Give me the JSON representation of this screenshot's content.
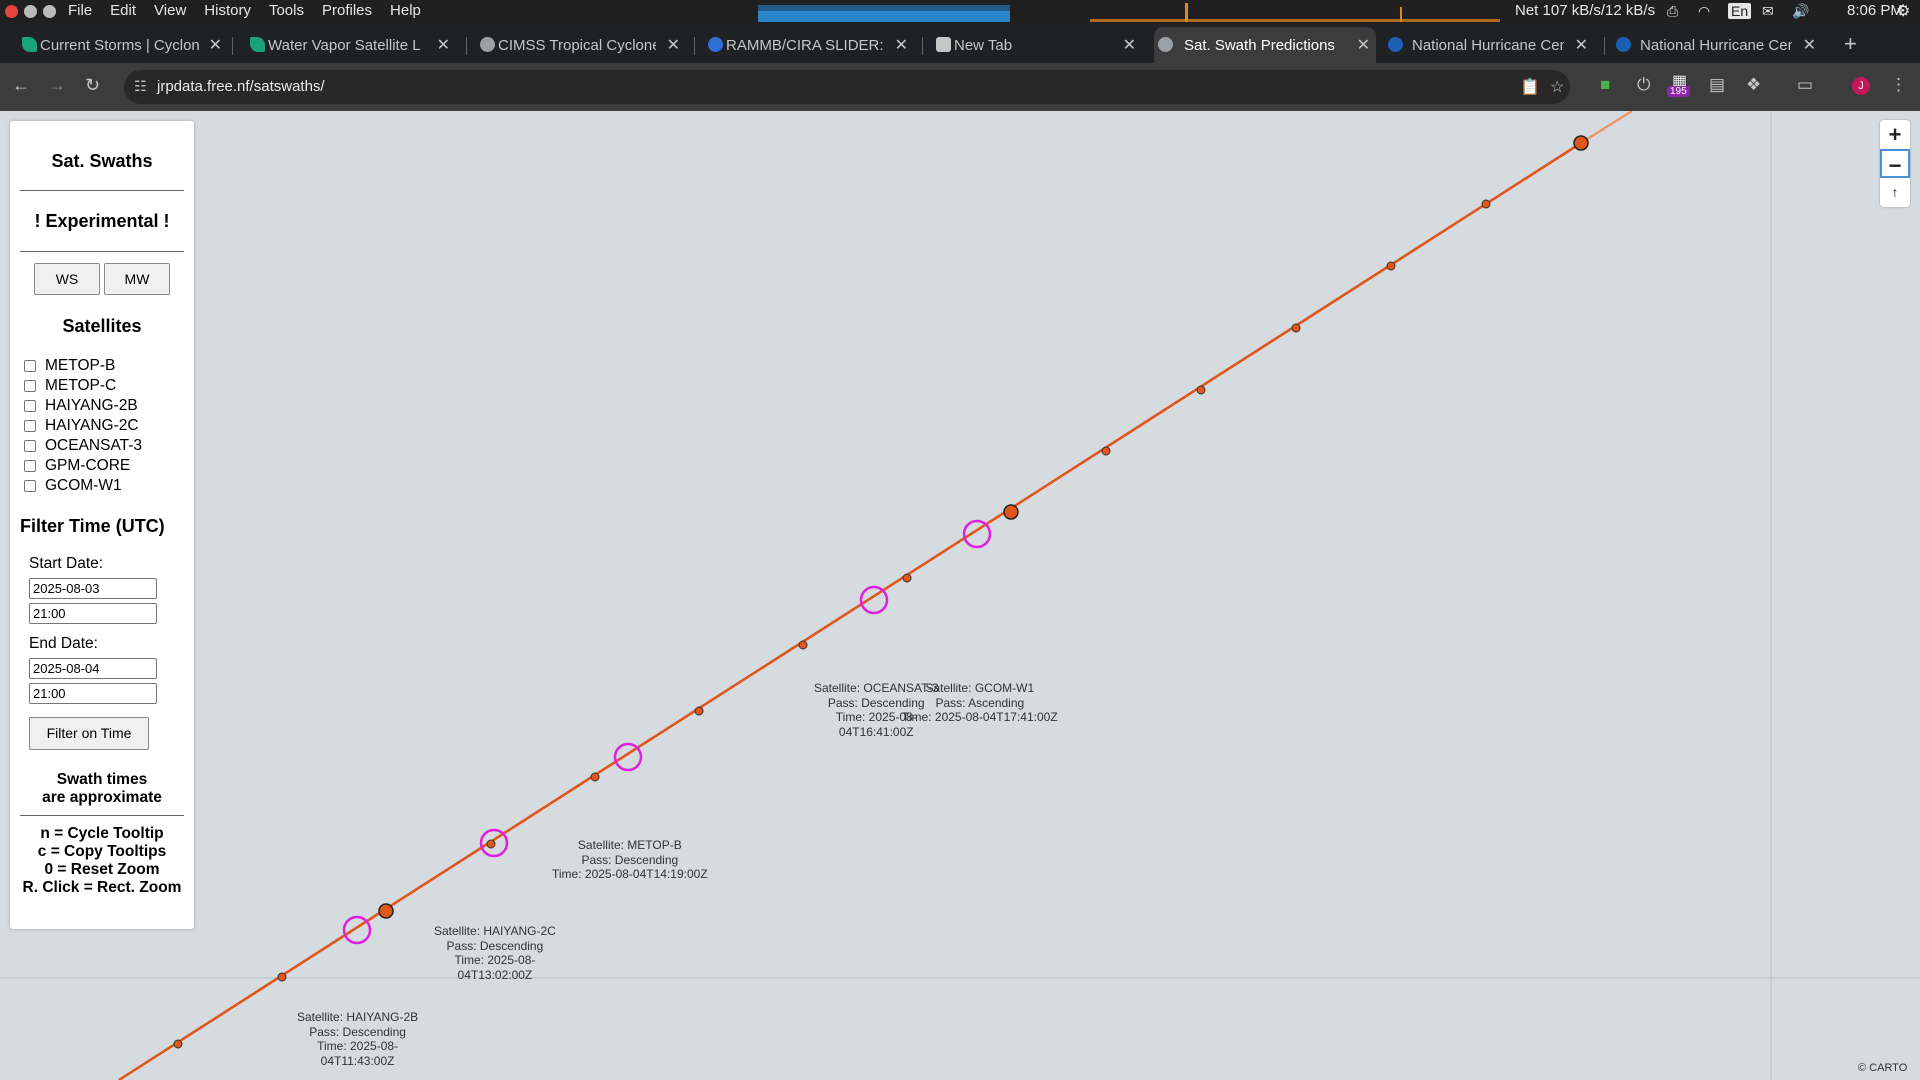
{
  "os": {
    "menu": [
      "File",
      "Edit",
      "View",
      "History",
      "Tools",
      "Profiles",
      "Help"
    ],
    "net": "Net 107 kB/s/12 kB/s",
    "keyboard": "En",
    "clock": "8:06 PM"
  },
  "tabs": [
    {
      "label": "Current Storms | Cyclon",
      "icon": "teal-leaf-icon"
    },
    {
      "label": "Water Vapor Satellite L",
      "icon": "teal-leaf-icon"
    },
    {
      "label": "CIMSS Tropical Cyclone",
      "icon": "cimss-icon"
    },
    {
      "label": "RAMMB/CIRA SLIDER: ",
      "icon": "globe-icon"
    },
    {
      "label": "New Tab",
      "icon": "incognito-icon"
    },
    {
      "label": "Sat. Swath Predictions",
      "icon": "globe-grey-icon",
      "active": true
    },
    {
      "label": "National Hurricane Cen",
      "icon": "noaa-icon"
    },
    {
      "label": "National Hurricane Cen",
      "icon": "noaa-icon"
    }
  ],
  "address": {
    "url": "jrpdata.free.nf/satswaths/",
    "extension_badge": "195",
    "profile_initial": "J"
  },
  "panel": {
    "title": "Sat. Swaths",
    "experimental": "! Experimental !",
    "btn_ws": "WS",
    "btn_mw": "MW",
    "satellites_heading": "Satellites",
    "satellites": [
      "METOP-B",
      "METOP-C",
      "HAIYANG-2B",
      "HAIYANG-2C",
      "OCEANSAT-3",
      "GPM-CORE",
      "GCOM-W1"
    ],
    "filter_heading": "Filter Time (UTC)",
    "start_label": "Start Date:",
    "start_date": "2025-08-03",
    "start_time": "21:00",
    "end_label": "End Date:",
    "end_date": "2025-08-04",
    "end_time": "21:00",
    "filter_btn": "Filter on Time",
    "swath_note_1": "Swath times",
    "swath_note_2": "are approximate",
    "key_1": "n = Cycle Tooltip",
    "key_2": "c = Copy Tooltips",
    "key_3": "0 = Reset Zoom",
    "key_4": "R. Click = Rect. Zoom"
  },
  "zoom": {
    "plus": "+",
    "minus": "−",
    "reset": "↑"
  },
  "tooltips": [
    {
      "lines": [
        "Satellite: OCEANSAT-3",
        "Pass: Descending",
        "Time: 2025-08-",
        "04T16:41:00Z"
      ]
    },
    {
      "lines": [
        "Satellite: GCOM-W1",
        "Pass: Ascending",
        "Time: 2025-08-04T17:41:00Z"
      ]
    },
    {
      "lines": [
        "Satellite: METOP-B",
        "Pass: Descending",
        "Time: 2025-08-04T14:19:00Z"
      ]
    },
    {
      "lines": [
        "Satellite: HAIYANG-2C",
        "Pass: Descending",
        "Time: 2025-08-",
        "04T13:02:00Z"
      ]
    },
    {
      "lines": [
        "Satellite: HAIYANG-2B",
        "Pass: Descending",
        "Time: 2025-08-",
        "04T11:43:00Z"
      ]
    }
  ],
  "attribution": "© CARTO",
  "colors": {
    "track": "#e0561b",
    "swath_marker": "#e020e0",
    "map_bg": "#d5dbde"
  }
}
